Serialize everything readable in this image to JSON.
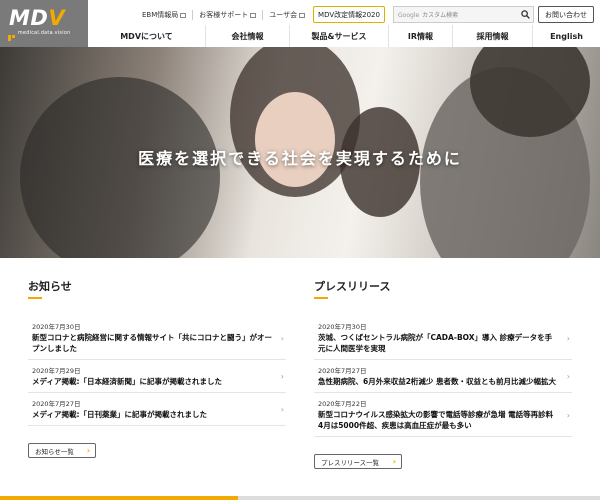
{
  "brand": {
    "logo_main": "MD",
    "logo_accent": "V",
    "logo_sub": "medical.data.vision"
  },
  "header": {
    "top_links": [
      "EBM情報局",
      "お客様サポート",
      "ユーザ会"
    ],
    "mdv_button": "MDV改定情報2020",
    "search": {
      "brand_label": "Google",
      "placeholder": "カスタム検索"
    },
    "contact_button": "お問い合わせ"
  },
  "nav": {
    "items": [
      "MDVについて",
      "会社情報",
      "製品&サービス",
      "IR情報",
      "採用情報",
      "English"
    ]
  },
  "hero": {
    "title": "医療を選択できる社会を実現するために"
  },
  "news": {
    "title": "お知らせ",
    "items": [
      {
        "date": "2020年7月30日",
        "text": "新型コロナと病院経営に関する情報サイト「共にコロナと闘う」がオープンしました"
      },
      {
        "date": "2020年7月29日",
        "text": "メディア掲載:「日本経済新聞」に記事が掲載されました"
      },
      {
        "date": "2020年7月27日",
        "text": "メディア掲載:「日刊薬業」に記事が掲載されました"
      }
    ],
    "more_label": "お知らせ一覧"
  },
  "press": {
    "title": "プレスリリース",
    "items": [
      {
        "date": "2020年7月30日",
        "text": "茨城、つくばセントラル病院が「CADA-BOX」導入 診療データを手元に人間医学を実現"
      },
      {
        "date": "2020年7月27日",
        "text": "急性期病院、6月外来収益2桁減少 患者数・収益とも前月比減少幅拡大"
      },
      {
        "date": "2020年7月22日",
        "text": "新型コロナウイルス感染拡大の影響で電話等診療が急増 電話等再診料4月は5000件超、疾患は高血圧症が最も多い"
      }
    ],
    "more_label": "プレスリリース一覧"
  },
  "colors": {
    "accent": "#f2a900",
    "logo_bg": "#7a7a7a"
  },
  "icons": {
    "search": "search-icon",
    "external": "external-link-icon",
    "chevron": "chevron-right-icon"
  }
}
